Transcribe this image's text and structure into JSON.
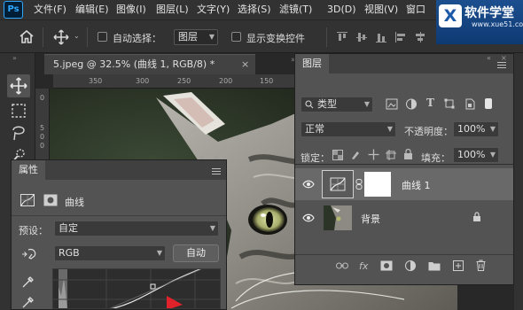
{
  "menubar": {
    "logo": "Ps",
    "items": [
      "文件(F)",
      "编辑(E)",
      "图像(I)",
      "图层(L)",
      "文字(Y)",
      "选择(S)",
      "滤镜(T)",
      "3D(D)",
      "视图(V)",
      "窗口"
    ]
  },
  "watermark": {
    "logo_letter": "X",
    "title": "软件学堂",
    "url": "www.xue51.com"
  },
  "options": {
    "auto_select_label": "自动选择：",
    "auto_select_target": "图层",
    "show_transform_label": "显示变换控件"
  },
  "document": {
    "tab_title": "5.jpeg @ 32.5% (曲线 1, RGB/8) *",
    "close": "×",
    "ruler_top": [
      "350",
      "300",
      "250",
      "200",
      "150",
      "100",
      "50",
      "0",
      "50"
    ],
    "ruler_left": [
      "0",
      "5",
      "0",
      "0",
      "1",
      "0",
      "0"
    ]
  },
  "layers": {
    "tab_title": "图层",
    "filter_kind": "类型",
    "blend_mode": "正常",
    "opacity_label": "不透明度：",
    "opacity_value": "100%",
    "lock_label": "锁定：",
    "fill_label": "填充：",
    "fill_value": "100%",
    "items": [
      {
        "name": "曲线 1",
        "selected": true
      },
      {
        "name": "背景",
        "locked": true
      }
    ],
    "footer": [
      "link",
      "fx",
      "mask",
      "adjustment",
      "group",
      "new-layer",
      "trash"
    ]
  },
  "properties": {
    "tab_title": "属性",
    "layer_type": "曲线",
    "preset_label": "预设：",
    "preset_value": "自定",
    "channel": "RGB",
    "auto_button": "自动"
  },
  "colors": {
    "accent": "#31a8ff",
    "panel": "#535353",
    "chrome": "#323232",
    "workspace": "#282828",
    "curve_marker": "#e0222b"
  }
}
